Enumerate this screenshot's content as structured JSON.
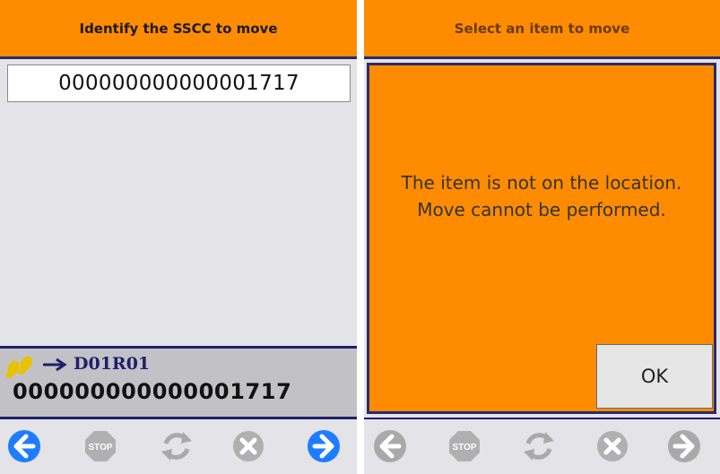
{
  "left_panel": {
    "title": "Identify the SSCC to move",
    "sscc_input_value": "000000000000001717",
    "info": {
      "location": "D01R01",
      "sscc": "000000000000001717"
    },
    "toolbar": {
      "back_icon": "back-arrow-icon",
      "stop_label": "STOP",
      "refresh_icon": "refresh-icon",
      "cancel_icon": "cancel-icon",
      "next_icon": "forward-arrow-icon"
    }
  },
  "right_panel": {
    "title": "Select an item to move",
    "message": "The item is not on the location. Move cannot be performed.",
    "ok_label": "OK",
    "toolbar": {
      "stop_label": "STOP"
    }
  },
  "colors": {
    "header_orange": "#ff8c00",
    "navy": "#1f1f6b",
    "active_blue": "#1e7cff",
    "disabled_gray": "#a9a9a9"
  }
}
